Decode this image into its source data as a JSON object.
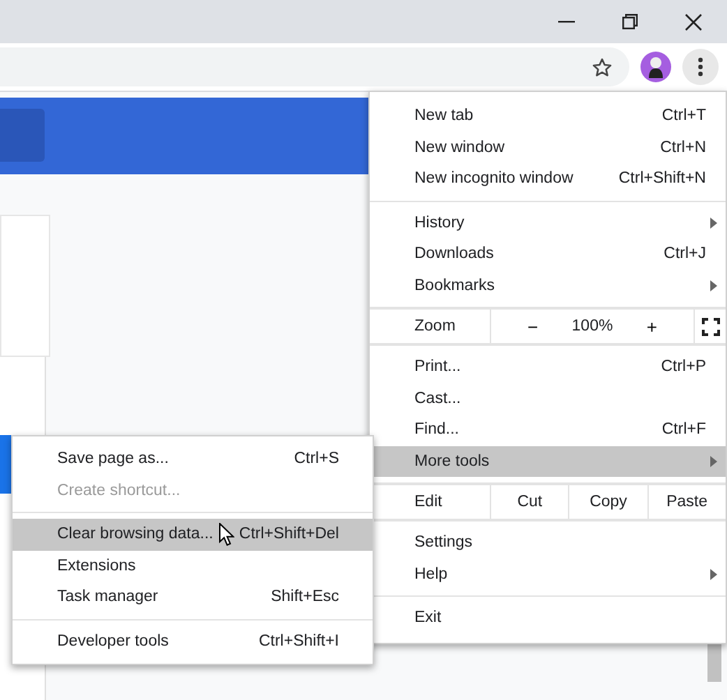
{
  "main_menu": {
    "items": [
      {
        "kind": "item",
        "label": "New tab",
        "shortcut": "Ctrl+T",
        "submenu": false,
        "highlighted": false
      },
      {
        "kind": "item",
        "label": "New window",
        "shortcut": "Ctrl+N",
        "submenu": false,
        "highlighted": false
      },
      {
        "kind": "item",
        "label": "New incognito window",
        "shortcut": "Ctrl+Shift+N",
        "submenu": false,
        "highlighted": false
      },
      {
        "kind": "separator"
      },
      {
        "kind": "item",
        "label": "History",
        "submenu": true,
        "highlighted": false
      },
      {
        "kind": "item",
        "label": "Downloads",
        "shortcut": "Ctrl+J",
        "submenu": false,
        "highlighted": false
      },
      {
        "kind": "item",
        "label": "Bookmarks",
        "submenu": true,
        "highlighted": false
      },
      {
        "kind": "separator"
      },
      {
        "kind": "zoom",
        "label": "Zoom",
        "minus": "−",
        "value": "100%",
        "plus": "+"
      },
      {
        "kind": "separator"
      },
      {
        "kind": "item",
        "label": "Print...",
        "shortcut": "Ctrl+P",
        "submenu": false,
        "highlighted": false
      },
      {
        "kind": "item",
        "label": "Cast...",
        "submenu": false,
        "highlighted": false
      },
      {
        "kind": "item",
        "label": "Find...",
        "shortcut": "Ctrl+F",
        "submenu": false,
        "highlighted": false
      },
      {
        "kind": "item",
        "label": "More tools",
        "submenu": true,
        "highlighted": true
      },
      {
        "kind": "separator"
      },
      {
        "kind": "edit",
        "label": "Edit",
        "buttons": [
          "Cut",
          "Copy",
          "Paste"
        ]
      },
      {
        "kind": "separator"
      },
      {
        "kind": "item",
        "label": "Settings",
        "submenu": false,
        "highlighted": false
      },
      {
        "kind": "item",
        "label": "Help",
        "submenu": true,
        "highlighted": false
      },
      {
        "kind": "separator"
      },
      {
        "kind": "item",
        "label": "Exit",
        "submenu": false,
        "highlighted": false
      }
    ]
  },
  "submenu": {
    "items": [
      {
        "kind": "item",
        "label": "Save page as...",
        "shortcut": "Ctrl+S",
        "disabled": false,
        "highlighted": false
      },
      {
        "kind": "item",
        "label": "Create shortcut...",
        "disabled": true,
        "highlighted": false
      },
      {
        "kind": "separator"
      },
      {
        "kind": "item",
        "label": "Clear browsing data...",
        "shortcut": "Ctrl+Shift+Del",
        "disabled": false,
        "highlighted": true,
        "pointer": true
      },
      {
        "kind": "item",
        "label": "Extensions",
        "disabled": false,
        "highlighted": false
      },
      {
        "kind": "item",
        "label": "Task manager",
        "shortcut": "Shift+Esc",
        "disabled": false,
        "highlighted": false
      },
      {
        "kind": "separator"
      },
      {
        "kind": "item",
        "label": "Developer tools",
        "shortcut": "Ctrl+Shift+I",
        "disabled": false,
        "highlighted": false
      }
    ]
  }
}
